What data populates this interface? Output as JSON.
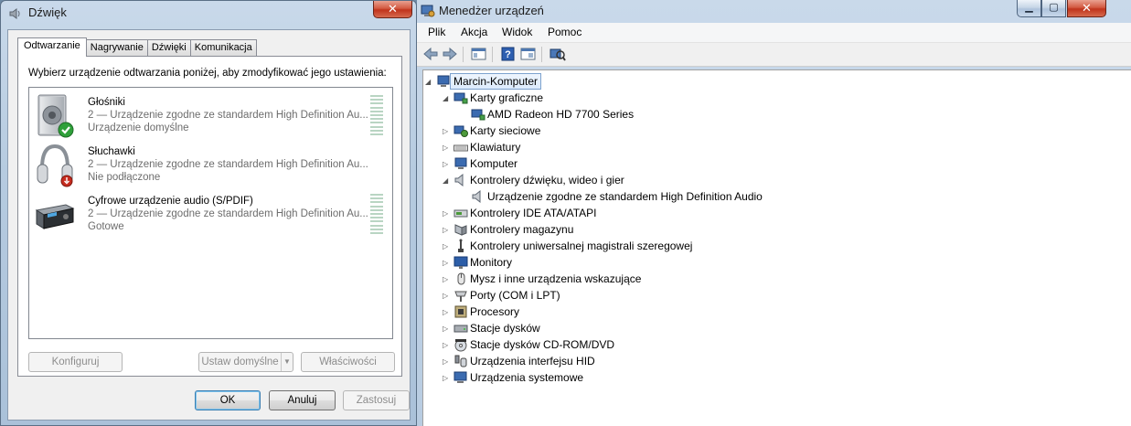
{
  "sound_dialog": {
    "title": "Dźwięk",
    "close_glyph": "✕",
    "tabs": [
      {
        "label": "Odtwarzanie",
        "active": true
      },
      {
        "label": "Nagrywanie"
      },
      {
        "label": "Dźwięki"
      },
      {
        "label": "Komunikacja"
      }
    ],
    "instruction": "Wybierz urządzenie odtwarzania poniżej, aby zmodyfikować jego ustawienia:",
    "devices": [
      {
        "name": "Głośniki",
        "description": "2 — Urządzenie zgodne ze standardem High Definition Au...",
        "status": "Urządzenie domyślne",
        "icon": "speaker-icon",
        "badge": "default-check-icon"
      },
      {
        "name": "Słuchawki",
        "description": "2 — Urządzenie zgodne ze standardem High Definition Au...",
        "status": "Nie podłączone",
        "icon": "headphones-icon",
        "badge": "unplugged-icon"
      },
      {
        "name": "Cyfrowe urządzenie audio (S/PDIF)",
        "description": "2 — Urządzenie zgodne ze standardem High Definition Au...",
        "status": "Gotowe",
        "icon": "spdif-device-icon"
      }
    ],
    "buttons": {
      "configure": "Konfiguruj",
      "set_default": "Ustaw domyślne",
      "properties": "Właściwości",
      "ok": "OK",
      "cancel": "Anuluj",
      "apply": "Zastosuj"
    }
  },
  "device_manager": {
    "title": "Menedżer urządzeń",
    "caption_glyphs": {
      "minimize": "▁",
      "maximize": "▢",
      "close": "✕"
    },
    "menu": [
      "Plik",
      "Akcja",
      "Widok",
      "Pomoc"
    ],
    "toolbar_icons": [
      "back-arrow-icon",
      "forward-arrow-icon",
      "show-hide-tree-icon",
      "help-icon",
      "properties-view-icon",
      "scan-hardware-icon"
    ],
    "tree": {
      "root": "Marcin-Komputer",
      "items": [
        {
          "label": "Karty graficzne",
          "expanded": true,
          "icon": "display-adapter-icon",
          "children": [
            "AMD Radeon HD 7700 Series"
          ]
        },
        {
          "label": "Karty sieciowe",
          "icon": "network-adapter-icon"
        },
        {
          "label": "Klawiatury",
          "icon": "keyboard-icon"
        },
        {
          "label": "Komputer",
          "icon": "computer-icon"
        },
        {
          "label": "Kontrolery dźwięku, wideo i gier",
          "expanded": true,
          "icon": "sound-controller-icon",
          "children": [
            "Urządzenie zgodne ze standardem High Definition Audio"
          ]
        },
        {
          "label": "Kontrolery IDE ATA/ATAPI",
          "icon": "ide-controller-icon"
        },
        {
          "label": "Kontrolery magazynu",
          "icon": "storage-controller-icon"
        },
        {
          "label": "Kontrolery uniwersalnej magistrali szeregowej",
          "icon": "usb-controller-icon"
        },
        {
          "label": "Monitory",
          "icon": "monitor-icon"
        },
        {
          "label": "Mysz i inne urządzenia wskazujące",
          "icon": "mouse-icon"
        },
        {
          "label": "Porty (COM i LPT)",
          "icon": "port-icon"
        },
        {
          "label": "Procesory",
          "icon": "processor-icon"
        },
        {
          "label": "Stacje dysków",
          "icon": "disk-drive-icon"
        },
        {
          "label": "Stacje dysków CD-ROM/DVD",
          "icon": "cdrom-icon"
        },
        {
          "label": "Urządzenia interfejsu HID",
          "icon": "hid-icon"
        },
        {
          "label": "Urządzenia systemowe",
          "icon": "system-device-icon"
        }
      ]
    }
  },
  "colors": {
    "titlebar": "#c2d5ea",
    "close_red": "#c7432b",
    "selection_border": "#7da2ce",
    "disabled_text": "#8d8d8d"
  }
}
